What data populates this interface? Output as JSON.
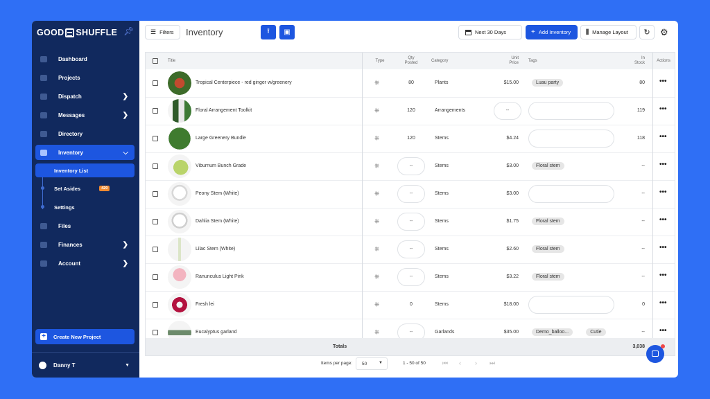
{
  "brand": {
    "logo_left": "GOOD",
    "logo_right": "SHUFFLE"
  },
  "sidebar": {
    "items": [
      {
        "label": "Dashboard"
      },
      {
        "label": "Projects"
      },
      {
        "label": "Dispatch"
      },
      {
        "label": "Messages"
      },
      {
        "label": "Directory"
      },
      {
        "label": "Inventory"
      },
      {
        "label": "Files"
      },
      {
        "label": "Finances"
      },
      {
        "label": "Account"
      }
    ],
    "subitems": [
      {
        "label": "Inventory List"
      },
      {
        "label": "Set Asides",
        "badge": "420"
      },
      {
        "label": "Settings"
      }
    ],
    "create_label": "Create New Project",
    "user_name": "Danny T"
  },
  "toolbar": {
    "filters_label": "Filters",
    "page_title": "Inventory",
    "date_range": "Next 30 Days",
    "add_label": "Add Inventory",
    "manage_label": "Manage Layout"
  },
  "table": {
    "headers": {
      "title": "Title",
      "type": "Type",
      "qty_1": "Qty",
      "qty_2": "Posted",
      "category": "Category",
      "price_1": "Unit",
      "price_2": "Price",
      "tags": "Tags",
      "stock_1": "In",
      "stock_2": "Stock",
      "actions": "Actions"
    },
    "rows": [
      {
        "title": "Tropical Centerpiece - red ginger w/greenery",
        "qty": "80",
        "category": "Plants",
        "price": "$15.00",
        "tags": [
          "Luau party"
        ],
        "stock": "80"
      },
      {
        "title": "Floral Arrangement Toolkit",
        "qty": "120",
        "category": "Arrangements",
        "price": "--",
        "tags": [],
        "stock": "119"
      },
      {
        "title": "Large Greenery Bundle",
        "qty": "120",
        "category": "Stems",
        "price": "$4.24",
        "tags": [],
        "stock": "118"
      },
      {
        "title": "Viburnum Bunch Grade",
        "qty": "--",
        "category": "Stems",
        "price": "$3.00",
        "tags": [
          "Floral stem"
        ],
        "stock": "--"
      },
      {
        "title": "Peony Stem (White)",
        "qty": "--",
        "category": "Stems",
        "price": "$3.00",
        "tags": [],
        "stock": "--"
      },
      {
        "title": "Dahlia Stem (White)",
        "qty": "--",
        "category": "Stems",
        "price": "$1.75",
        "tags": [
          "Floral stem"
        ],
        "stock": "--"
      },
      {
        "title": "Lilac Stem (White)",
        "qty": "--",
        "category": "Stems",
        "price": "$2.60",
        "tags": [
          "Floral stem"
        ],
        "stock": "--"
      },
      {
        "title": "Ranunculus Light Pink",
        "qty": "--",
        "category": "Stems",
        "price": "$3.22",
        "tags": [
          "Floral stem"
        ],
        "stock": "--"
      },
      {
        "title": "Fresh lei",
        "qty": "0",
        "category": "Stems",
        "price": "$18.00",
        "tags": [],
        "stock": "0"
      },
      {
        "title": "Eucalyptus garland",
        "qty": "--",
        "category": "Garlands",
        "price": "$35.00",
        "tags": [
          "Demo_balloo...",
          "Cutie"
        ],
        "stock": "--"
      }
    ],
    "totals_label": "Totals",
    "totals_stock": "3,038"
  },
  "pager": {
    "items_per_page_label": "Items per page:",
    "page_size": "50",
    "range": "1 - 50 of 50"
  },
  "colors": {
    "accent": "#1d56e0",
    "sidebar": "#11295e",
    "background": "#2f6ff5"
  }
}
